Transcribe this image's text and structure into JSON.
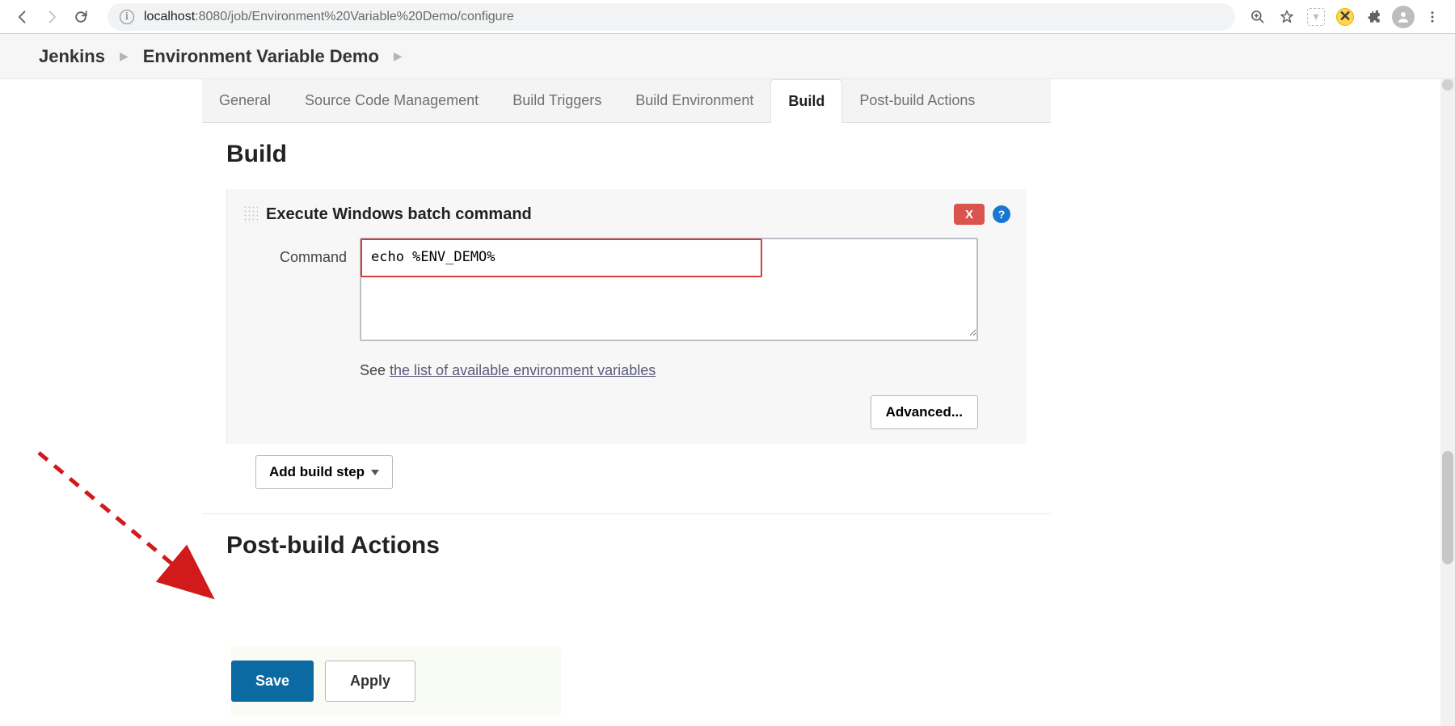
{
  "browser": {
    "url_host": "localhost",
    "url_port_path": ":8080/job/Environment%20Variable%20Demo/configure"
  },
  "breadcrumb": {
    "root": "Jenkins",
    "job": "Environment Variable Demo"
  },
  "tabs": {
    "general": "General",
    "scm": "Source Code Management",
    "triggers": "Build Triggers",
    "env": "Build Environment",
    "build": "Build",
    "post": "Post-build Actions"
  },
  "sections": {
    "build_heading": "Build",
    "post_heading": "Post-build Actions"
  },
  "build_step": {
    "title": "Execute Windows batch command",
    "delete_label": "X",
    "help_label": "?",
    "command_label": "Command",
    "command_value": "echo %ENV_DEMO%",
    "hint_prefix": "See ",
    "hint_link": "the list of available environment variables",
    "advanced_label": "Advanced...",
    "add_step_label": "Add build step"
  },
  "footer": {
    "save": "Save",
    "apply": "Apply"
  }
}
